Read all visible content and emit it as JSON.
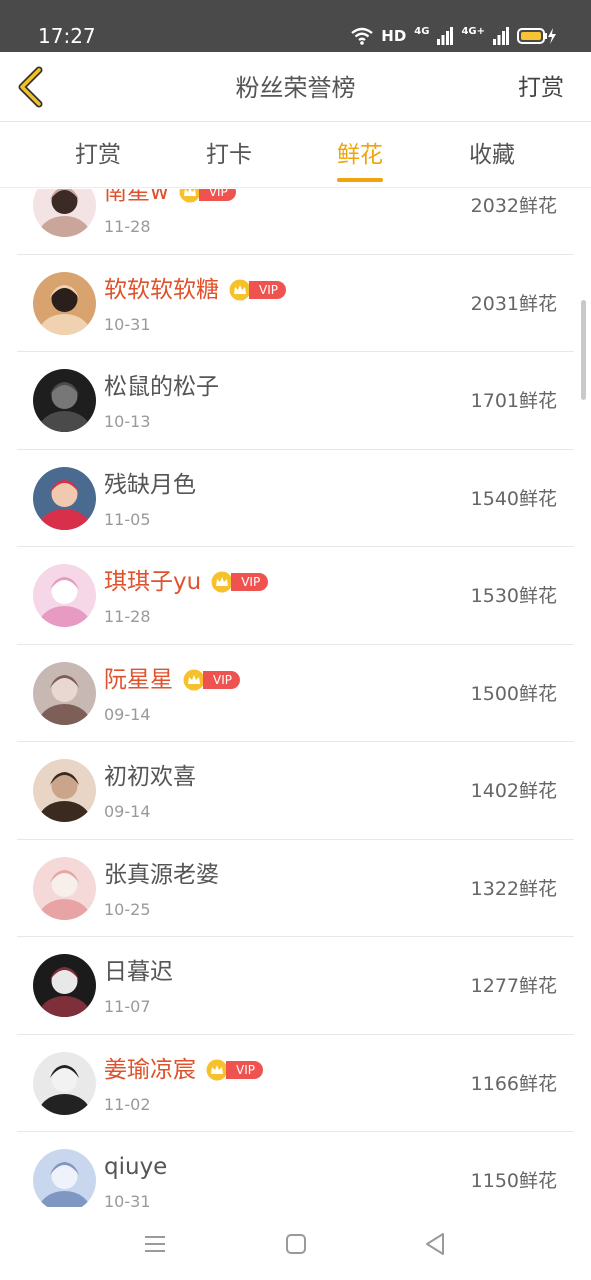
{
  "status_bar": {
    "time": "17:27",
    "hd_label": "HD",
    "signal_label_1": "4G",
    "signal_label_2": "4G+"
  },
  "nav": {
    "title": "粉丝荣誉榜",
    "right_action": "打赏",
    "back_icon": "chevron-left-icon"
  },
  "tabs": [
    {
      "label": "打赏",
      "active": false
    },
    {
      "label": "打卡",
      "active": false
    },
    {
      "label": "鲜花",
      "active": true
    },
    {
      "label": "收藏",
      "active": false
    }
  ],
  "vip_label": "VIP",
  "colors": {
    "accent": "#f0a30a",
    "vip_name": "#e0522c",
    "vip_tag": "#ef5350",
    "status_bar": "#4a4a4a"
  },
  "list": [
    {
      "name": "南星w",
      "vip": true,
      "date": "11-28",
      "amount": "2032鲜花"
    },
    {
      "name": "软软软软糖",
      "vip": true,
      "date": "10-31",
      "amount": "2031鲜花"
    },
    {
      "name": "松鼠的松子",
      "vip": false,
      "date": "10-13",
      "amount": "1701鲜花"
    },
    {
      "name": "残缺月色",
      "vip": false,
      "date": "11-05",
      "amount": "1540鲜花"
    },
    {
      "name": "琪琪子yu",
      "vip": true,
      "date": "11-28",
      "amount": "1530鲜花"
    },
    {
      "name": "阮星星",
      "vip": true,
      "date": "09-14",
      "amount": "1500鲜花"
    },
    {
      "name": "初初欢喜",
      "vip": false,
      "date": "09-14",
      "amount": "1402鲜花"
    },
    {
      "name": "张真源老婆",
      "vip": false,
      "date": "10-25",
      "amount": "1322鲜花"
    },
    {
      "name": "日暮迟",
      "vip": false,
      "date": "11-07",
      "amount": "1277鲜花"
    },
    {
      "name": "姜瑜凉宸",
      "vip": true,
      "date": "11-02",
      "amount": "1166鲜花"
    },
    {
      "name": "qiuye",
      "vip": false,
      "date": "10-31",
      "amount": "1150鲜花"
    }
  ],
  "system_nav": [
    "menu-icon",
    "home-icon",
    "back-triangle-icon"
  ]
}
